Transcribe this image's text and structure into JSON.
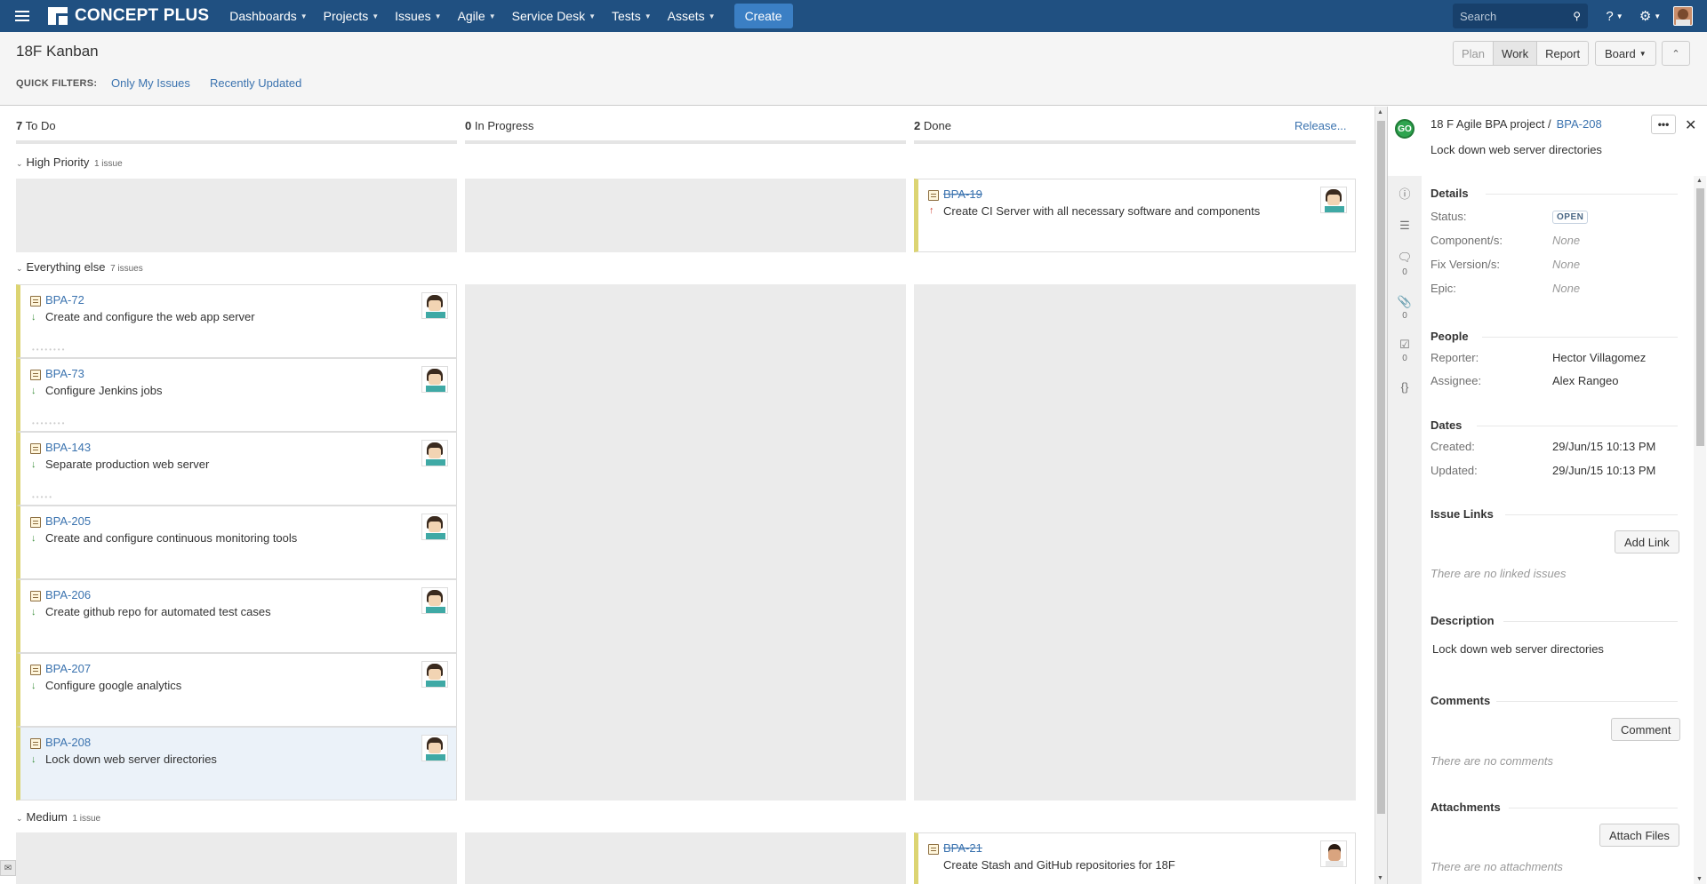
{
  "nav": {
    "logo": "CONCEPT PLUS",
    "items": [
      "Dashboards",
      "Projects",
      "Issues",
      "Agile",
      "Service Desk",
      "Tests",
      "Assets"
    ],
    "create": "Create",
    "search_placeholder": "Search"
  },
  "header": {
    "title": "18F Kanban",
    "quick_filters_label": "QUICK FILTERS:",
    "quick_filters": [
      "Only My Issues",
      "Recently Updated"
    ],
    "modes": [
      "Plan",
      "Work",
      "Report"
    ],
    "board": "Board"
  },
  "columns": [
    {
      "count": "7",
      "name": "To Do"
    },
    {
      "count": "0",
      "name": "In Progress"
    },
    {
      "count": "2",
      "name": "Done"
    }
  ],
  "release": "Release...",
  "swimlanes": [
    {
      "name": "High Priority",
      "count": "1 issue"
    },
    {
      "name": "Everything else",
      "count": "7 issues"
    },
    {
      "name": "Medium",
      "count": "1 issue"
    }
  ],
  "cards": {
    "high_done": {
      "key": "BPA-19",
      "summary": "Create CI Server with all necessary software and components"
    },
    "todo": [
      {
        "key": "BPA-72",
        "summary": "Create and configure the web app server"
      },
      {
        "key": "BPA-73",
        "summary": "Configure Jenkins jobs"
      },
      {
        "key": "BPA-143",
        "summary": "Separate production web server"
      },
      {
        "key": "BPA-205",
        "summary": "Create and configure continuous monitoring tools"
      },
      {
        "key": "BPA-206",
        "summary": "Create github repo for automated test cases"
      },
      {
        "key": "BPA-207",
        "summary": "Configure google analytics"
      },
      {
        "key": "BPA-208",
        "summary": "Lock down web server directories"
      }
    ],
    "medium_done": {
      "key": "BPA-21",
      "summary": "Create Stash and GitHub repositories for 18F"
    }
  },
  "detail": {
    "go_badge": "GO",
    "project": "18 F Agile BPA project /",
    "key": "BPA-208",
    "title": "Lock down web server directories",
    "more": "•••",
    "close": "✕",
    "rail_counts": [
      "0",
      "0",
      "0"
    ],
    "details": {
      "heading": "Details",
      "status_label": "Status:",
      "status_value": "OPEN",
      "component_label": "Component/s:",
      "component_value": "None",
      "fix_label": "Fix Version/s:",
      "fix_value": "None",
      "epic_label": "Epic:",
      "epic_value": "None"
    },
    "people": {
      "heading": "People",
      "reporter_label": "Reporter:",
      "reporter_value": "Hector Villagomez",
      "assignee_label": "Assignee:",
      "assignee_value": "Alex Rangeo"
    },
    "dates": {
      "heading": "Dates",
      "created_label": "Created:",
      "created_value": "29/Jun/15 10:13 PM",
      "updated_label": "Updated:",
      "updated_value": "29/Jun/15 10:13 PM"
    },
    "links": {
      "heading": "Issue Links",
      "button": "Add Link",
      "empty": "There are no linked issues"
    },
    "description": {
      "heading": "Description",
      "text": "Lock down web server directories"
    },
    "comments": {
      "heading": "Comments",
      "button": "Comment",
      "empty": "There are no comments"
    },
    "attachments": {
      "heading": "Attachments",
      "button": "Attach Files",
      "empty": "There are no attachments"
    }
  },
  "colors": {
    "nav": "#205081",
    "link": "#3b73af",
    "card_stripe": "#dcd472",
    "create": "#3b7fc4"
  }
}
